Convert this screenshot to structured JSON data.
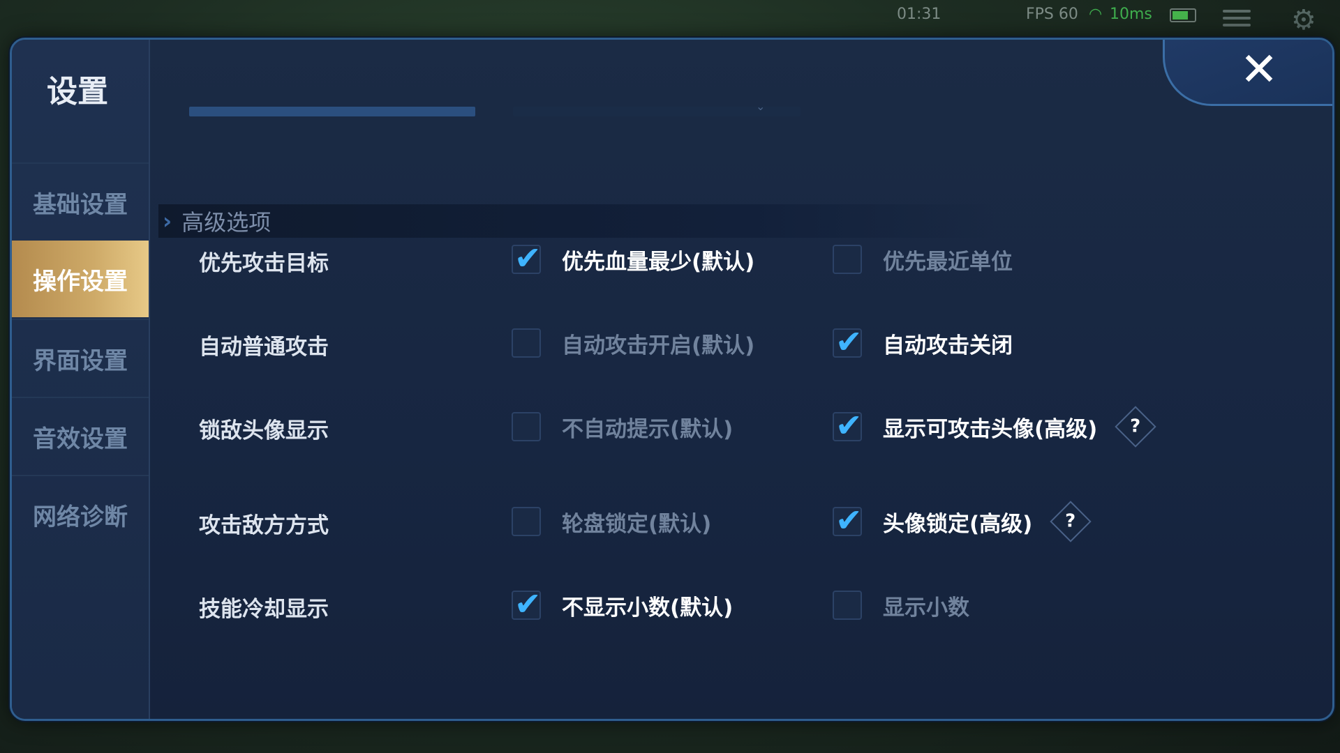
{
  "hud": {
    "time": "01:31",
    "fps": "FPS 60",
    "ping": "10ms"
  },
  "dialog": {
    "title": "设置",
    "close_label": "✕"
  },
  "sidebar": {
    "items": [
      {
        "label": "基础设置",
        "active": false
      },
      {
        "label": "操作设置",
        "active": true
      },
      {
        "label": "界面设置",
        "active": false
      },
      {
        "label": "音效设置",
        "active": false
      },
      {
        "label": "网络诊断",
        "active": false
      }
    ]
  },
  "section": {
    "title": "高级选项"
  },
  "rows": [
    {
      "label": "优先攻击目标",
      "options": [
        {
          "label": "优先血量最少(默认)",
          "checked": true
        },
        {
          "label": "优先最近单位",
          "checked": false
        }
      ]
    },
    {
      "label": "自动普通攻击",
      "options": [
        {
          "label": "自动攻击开启(默认)",
          "checked": false
        },
        {
          "label": "自动攻击关闭",
          "checked": true
        }
      ]
    },
    {
      "label": "锁敌头像显示",
      "options": [
        {
          "label": "不自动提示(默认)",
          "checked": false
        },
        {
          "label": "显示可攻击头像(高级)",
          "checked": true,
          "help": "?"
        }
      ]
    },
    {
      "label": "攻击敌方方式",
      "options": [
        {
          "label": "轮盘锁定(默认)",
          "checked": false
        },
        {
          "label": "头像锁定(高级)",
          "checked": true,
          "help": "?"
        }
      ]
    },
    {
      "label": "技能冷却显示",
      "options": [
        {
          "label": "不显示小数(默认)",
          "checked": true
        },
        {
          "label": "显示小数",
          "checked": false
        }
      ]
    }
  ],
  "colors": {
    "accent_check": "#3fb4ff",
    "active_tab_gold": "#ceaa68",
    "panel_bg": "#1b2b45"
  }
}
